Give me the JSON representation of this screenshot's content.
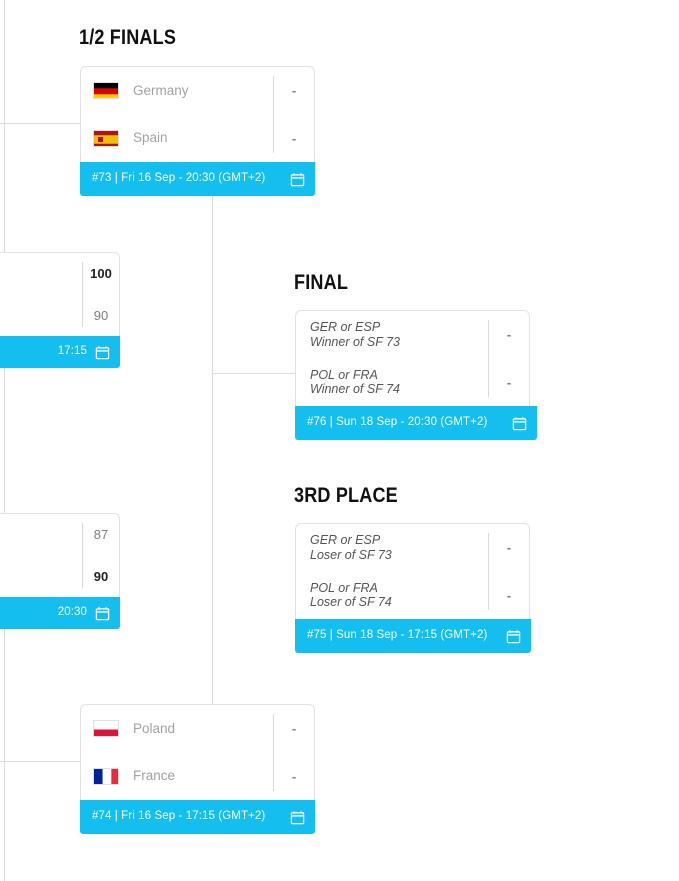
{
  "page": {
    "background": "#ffffff",
    "accent": "#14beef",
    "line_color": "#dcdcdc"
  },
  "rounds": [
    {
      "id": "semifinals",
      "title": "1/2 Finals"
    },
    {
      "id": "final",
      "title": "Final"
    },
    {
      "id": "third-place",
      "title": "3rd Place"
    }
  ],
  "matches": [
    {
      "id": "sf-73",
      "round": "semifinals",
      "teams": [
        {
          "name": "Germany",
          "code": "GER",
          "flag": "germany-flag",
          "score": "-",
          "winner": false
        },
        {
          "name": "Spain",
          "code": "ESP",
          "flag": "spain-flag",
          "score": "-",
          "winner": false
        }
      ],
      "bar": {
        "label": "#73 | Fri 16 Sep - 20:30 (GMT+2)",
        "number": "#73",
        "day": "Fri 16 Sep",
        "time": "20:30",
        "tz": "(GMT+2)",
        "icon": "calendar-icon"
      }
    },
    {
      "id": "sf-74",
      "round": "semifinals",
      "teams": [
        {
          "name": "Poland",
          "code": "POL",
          "flag": "poland-flag",
          "score": "-",
          "winner": false
        },
        {
          "name": "France",
          "code": "FRA",
          "flag": "france-flag",
          "score": "-",
          "winner": false
        }
      ],
      "bar": {
        "label": "#74 | Fri 16 Sep - 17:15 (GMT+2)",
        "number": "#74",
        "day": "Fri 16 Sep",
        "time": "17:15",
        "tz": "(GMT+2)",
        "icon": "calendar-icon"
      }
    },
    {
      "id": "final-76",
      "round": "final",
      "teams": [
        {
          "name": "GER or ESP",
          "sub": "Winner of SF 73",
          "score": "-",
          "winner": false
        },
        {
          "name": "POL or FRA",
          "sub": "Winner of SF 74",
          "score": "-",
          "winner": false
        }
      ],
      "bar": {
        "label": "#76 | Sun 18 Sep - 20:30 (GMT+2)",
        "number": "#76",
        "day": "Sun 18 Sep",
        "time": "20:30",
        "tz": "(GMT+2)",
        "icon": "calendar-icon"
      }
    },
    {
      "id": "third-75",
      "round": "third-place",
      "teams": [
        {
          "name": "GER or ESP",
          "sub": "Loser of SF 73",
          "score": "-",
          "winner": false
        },
        {
          "name": "POL or FRA",
          "sub": "Loser of SF 74",
          "score": "-",
          "winner": false
        }
      ],
      "bar": {
        "label": "#75 | Sun 18 Sep - 17:15 (GMT+2)",
        "number": "#75",
        "day": "Sun 18 Sep",
        "time": "17:15",
        "tz": "(GMT+2)",
        "icon": "calendar-icon"
      }
    },
    {
      "id": "qf-upper",
      "round": "quarterfinals",
      "clipped": true,
      "teams": [
        {
          "name": "",
          "score": "100",
          "winner": true
        },
        {
          "name": "",
          "score": "90",
          "winner": false
        }
      ],
      "bar": {
        "label": "17:15",
        "time": "17:15",
        "icon": "calendar-icon"
      }
    },
    {
      "id": "qf-lower",
      "round": "quarterfinals",
      "clipped": true,
      "teams": [
        {
          "name": "",
          "score": "87",
          "winner": false
        },
        {
          "name": "",
          "score": "90",
          "winner": true
        }
      ],
      "bar": {
        "label": "20:30",
        "time": "20:30",
        "icon": "calendar-icon"
      }
    }
  ]
}
